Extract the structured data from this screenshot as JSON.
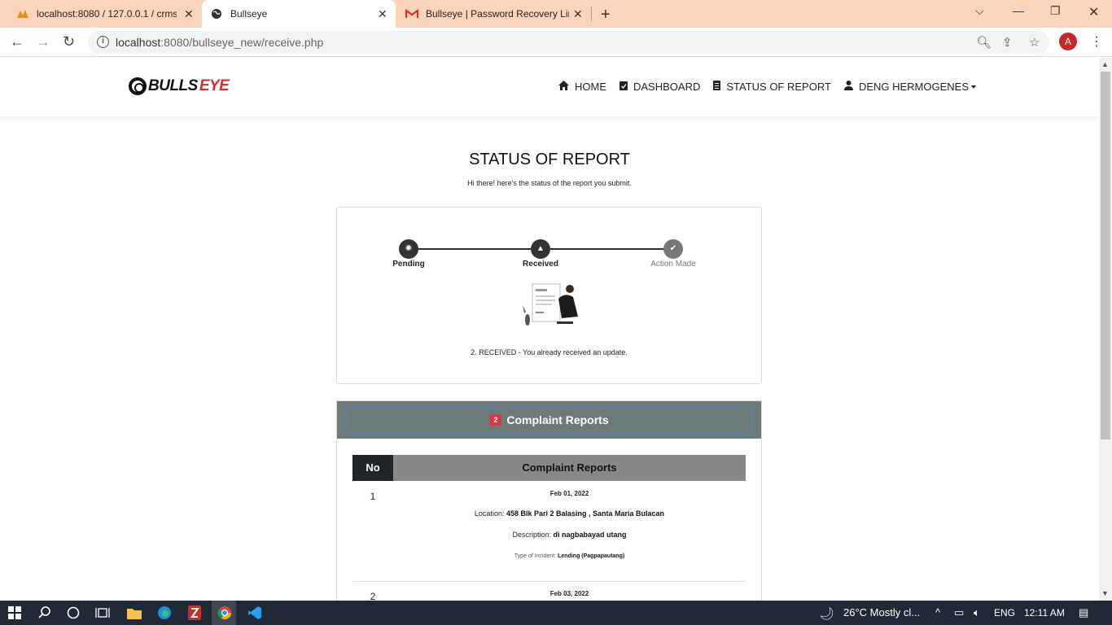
{
  "browser": {
    "tabs": [
      {
        "label": "localhost:8080 / 127.0.0.1 / crms_",
        "icon": "phpmyadmin-icon"
      },
      {
        "label": "Bullseye",
        "icon": "globe-icon"
      },
      {
        "label": "Bullseye | Password Recovery Lin",
        "icon": "gmail-icon"
      }
    ],
    "url_host": "localhost",
    "url_rest": ":8080/bullseye_new/receive.php",
    "profile_initial": "A"
  },
  "site": {
    "logo_part1": "BULLS",
    "logo_part2": "EYE",
    "nav": [
      {
        "label": "HOME",
        "icon": "home-icon"
      },
      {
        "label": "DASHBOARD",
        "icon": "clipboard-check-icon"
      },
      {
        "label": "STATUS OF REPORT",
        "icon": "receipt-icon"
      },
      {
        "label": "DENG HERMOGENES",
        "icon": "user-icon"
      }
    ]
  },
  "page": {
    "title": "STATUS OF REPORT",
    "subtitle": "Hi there! here's the status of the report you submit.",
    "steps": [
      {
        "label": "Pending",
        "state": "done"
      },
      {
        "label": "Received",
        "state": "current"
      },
      {
        "label": "Action Made",
        "state": "upcoming"
      }
    ],
    "status_message": "2. RECEIVED - You already received an update."
  },
  "reports": {
    "count": "2",
    "header_label": "Complaint Reports",
    "col_no": "No",
    "col_reports": "Complaint Reports",
    "location_label": "Location:",
    "description_label": "Description:",
    "type_label": "Type of Incident:",
    "rows": [
      {
        "no": "1",
        "date": "Feb 01, 2022",
        "location": "458 Blk Pari 2 Balasing , Santa Maria Bulacan",
        "description": "di nagbabayad utang",
        "type": "Lending (Pagpapautang)"
      },
      {
        "no": "2",
        "date": "Feb 03, 2022"
      }
    ]
  },
  "taskbar": {
    "weather": "26°C  Mostly cl...",
    "lang": "ENG",
    "time": "12:11 AM"
  },
  "colors": {
    "tabstrip": "#fbd4bb",
    "accent_red": "#d32f2f",
    "header_slate": "#6c7a7a",
    "badge": "#dc3545"
  }
}
